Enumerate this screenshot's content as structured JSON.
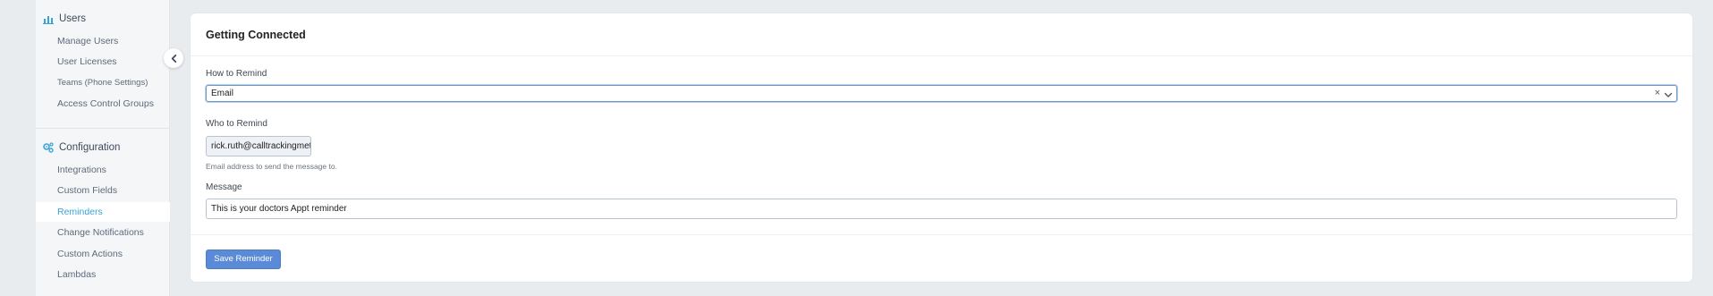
{
  "sidebar": {
    "users": {
      "title": "Users",
      "icon": "bar-chart-icon",
      "items": [
        {
          "label": "Manage Users"
        },
        {
          "label": "User Licenses"
        },
        {
          "label": "Teams (Phone Settings)"
        },
        {
          "label": "Access Control Groups"
        }
      ]
    },
    "configuration": {
      "title": "Configuration",
      "icon": "gears-icon",
      "items": [
        {
          "label": "Integrations"
        },
        {
          "label": "Custom Fields"
        },
        {
          "label": "Reminders",
          "active": true
        },
        {
          "label": "Change Notifications"
        },
        {
          "label": "Custom Actions"
        },
        {
          "label": "Lambdas"
        }
      ]
    },
    "collapse_icon": "chevron-left-icon"
  },
  "card": {
    "title": "Getting Connected",
    "how_to_remind": {
      "label": "How to Remind",
      "value": "Email",
      "clear_symbol": "×"
    },
    "who_to_remind": {
      "label": "Who to Remind",
      "value": "rick.ruth@calltrackingmetrics.com",
      "help": "Email address to send the message to."
    },
    "message": {
      "label": "Message",
      "value": "This is your doctors Appt reminder"
    },
    "save_label": "Save Reminder"
  },
  "colors": {
    "accent": "#3aa3d6",
    "button": "#5b8bd6",
    "background": "#e9ecef"
  }
}
